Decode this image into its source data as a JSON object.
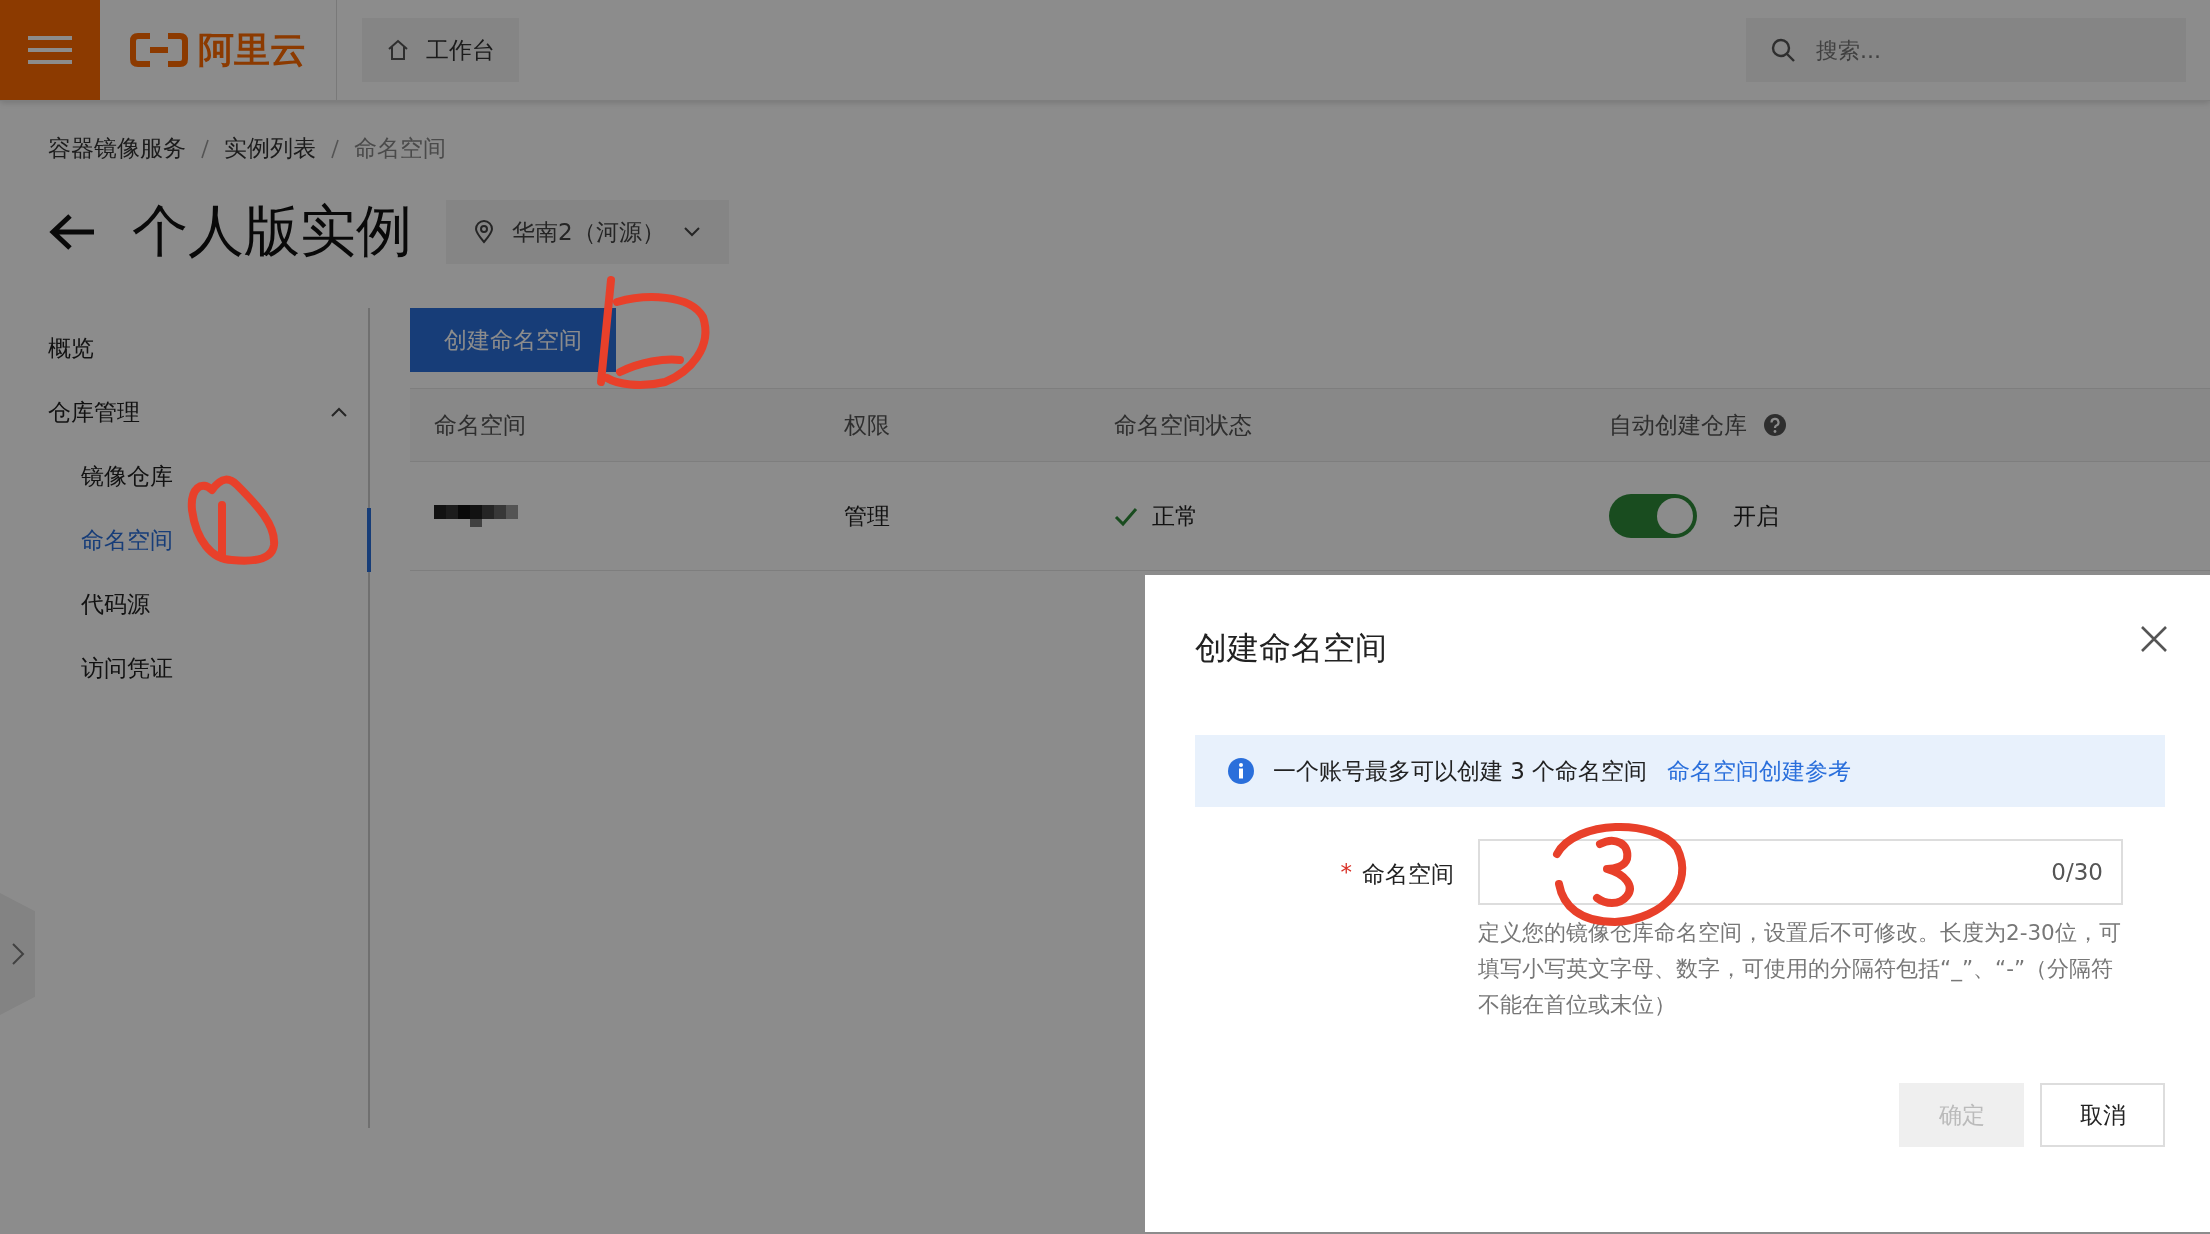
{
  "header": {
    "logo": "阿里云",
    "workbench": "工作台",
    "search": {
      "placeholder": "搜索..."
    }
  },
  "breadcrumb": [
    {
      "label": "容器镜像服务",
      "current": false
    },
    {
      "label": "实例列表",
      "current": false
    },
    {
      "label": "命名空间",
      "current": true
    }
  ],
  "page_title": "个人版实例",
  "region": "华南2（河源）",
  "sidebar": {
    "items": [
      {
        "label": "概览",
        "selected": false
      },
      {
        "label": "仓库管理",
        "expanded": true,
        "children": [
          {
            "label": "镜像仓库",
            "selected": false
          },
          {
            "label": "命名空间",
            "selected": true
          },
          {
            "label": "代码源",
            "selected": false
          },
          {
            "label": "访问凭证",
            "selected": false
          }
        ]
      }
    ]
  },
  "create_button": "创建命名空间",
  "table": {
    "columns": [
      {
        "label": "命名空间",
        "kind": "plain"
      },
      {
        "label": "权限",
        "kind": "plain"
      },
      {
        "label": "命名空间状态",
        "kind": "plain"
      },
      {
        "label": "自动创建仓库",
        "kind": "help"
      }
    ],
    "rows": [
      {
        "permission": "管理",
        "status": {
          "label": "正常",
          "kind": "normal"
        },
        "auto_create": {
          "on": true,
          "label": "开启"
        }
      }
    ]
  },
  "modal": {
    "title": "创建命名空间",
    "info": {
      "text": "一个账号最多可以创建 3 个命名空间",
      "link": "命名空间创建参考"
    },
    "field": {
      "label": "命名空间",
      "required": true,
      "required_mark": "*",
      "counter": "0/30",
      "hint": "定义您的镜像仓库命名空间，设置后不可修改。长度为2-30位，可填写小写英文字母、数字，可使用的分隔符包括“_”、“-”（分隔符不能在首位或末位）"
    },
    "buttons": [
      {
        "label": "确定",
        "disabled": true
      },
      {
        "label": "取消",
        "disabled": false
      }
    ]
  }
}
